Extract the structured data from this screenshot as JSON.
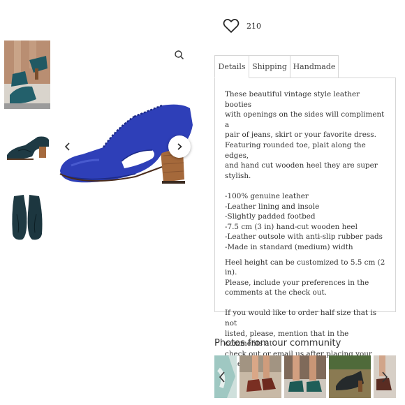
{
  "favorites": {
    "count": "210",
    "icon": "heart-outline-icon"
  },
  "tabs": [
    {
      "label": "Details",
      "active": true
    },
    {
      "label": "Shipping",
      "active": false
    },
    {
      "label": "Handmade",
      "active": false
    }
  ],
  "details": {
    "intro": [
      "These beautiful vintage style leather booties",
      "with openings on the sides will compliment a",
      "pair of jeans, skirt or your favorite dress.",
      "Featuring rounded toe, plait along the edges,",
      "and hand cut wooden heel they are super",
      "stylish."
    ],
    "features": [
      "-100% genuine leather",
      "-Leather lining and insole",
      "-Slightly padded footbed",
      "-7.5 cm (3 in) hand-cut wooden heel",
      "-Leather outsole with anti-slip rubber pads",
      "-Made in standard (medium) width"
    ],
    "heel_note": [
      "Heel height can be customized to 5.5 cm (2 in).",
      "Please, include your preferences in the",
      "comments at the check out."
    ],
    "size_note": [
      "If you would like to order half size that is not",
      "listed, please, mention that in the comments at",
      "check out or email us after placing your order."
    ]
  },
  "community": {
    "title": "Photos from our community"
  },
  "colors": {
    "shoe_blue": "#2e3fb8",
    "shoe_teal": "#1f3d44",
    "heel_wood": "#a0683c",
    "border": "#d6d6d6"
  }
}
